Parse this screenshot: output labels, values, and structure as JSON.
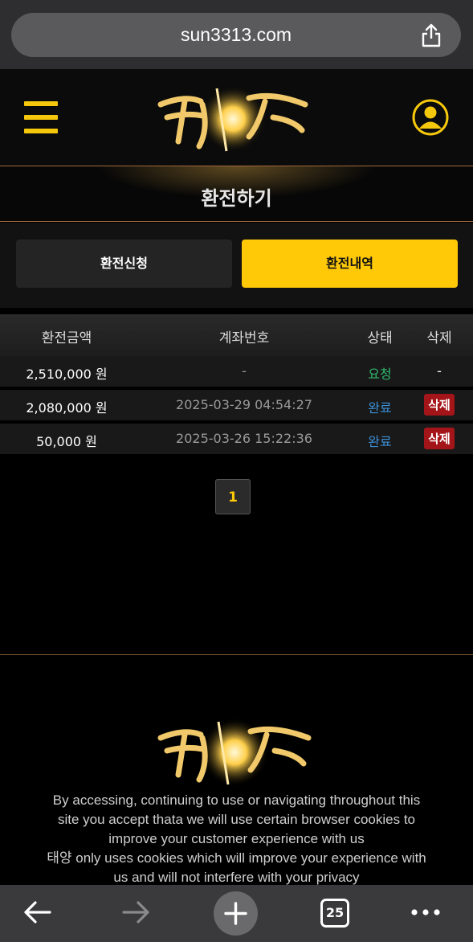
{
  "browser": {
    "url": "sun3313.com",
    "tabs_count": "25"
  },
  "header": {
    "logo_text": "태양"
  },
  "page": {
    "title": "환전하기",
    "tabs": [
      {
        "label": "환전신청",
        "active": false
      },
      {
        "label": "환전내역",
        "active": true
      }
    ]
  },
  "table": {
    "headers": [
      "환전금액",
      "계좌번호",
      "상태",
      "삭제"
    ],
    "rows": [
      {
        "amount": "2,510,000 원",
        "account": "-",
        "status": "요청",
        "status_color": "#2fb86b",
        "delete": "-"
      },
      {
        "amount": "2,080,000 원",
        "account": "2025-03-29 04:54:27",
        "status": "완료",
        "status_color": "#3b8fd6",
        "delete": "삭제"
      },
      {
        "amount": "50,000 원",
        "account": "2025-03-26 15:22:36",
        "status": "완료",
        "status_color": "#3b8fd6",
        "delete": "삭제"
      }
    ]
  },
  "pagination": {
    "current": "1"
  },
  "footer": {
    "cookie_lines": [
      "By accessing, continuing to use or navigating throughout this",
      "site you accept thata we will use certain browser cookies to",
      "improve your customer experience with us",
      "태양 only uses cookies which will improve your experience with",
      "us and will not interfere with your privacy"
    ]
  },
  "colors": {
    "accent": "#ffc907",
    "delete_badge": "#a41519"
  }
}
